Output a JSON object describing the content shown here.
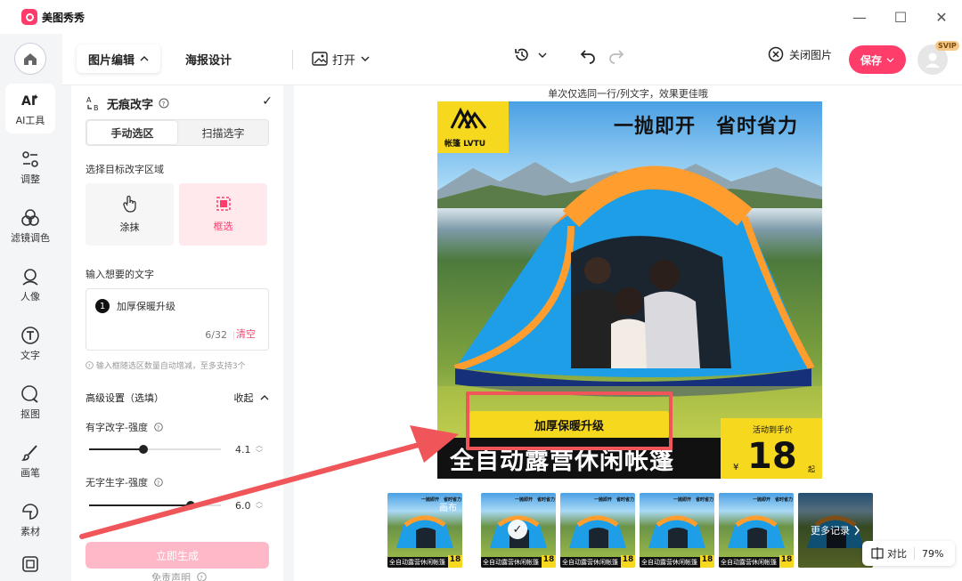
{
  "app": {
    "title": "美图秀秀"
  },
  "window": {
    "minimize": "—",
    "maximize": "☐",
    "close": "✕"
  },
  "rail": {
    "items": [
      {
        "label": "AI工具",
        "icon": "ai-tools-icon",
        "active": true
      },
      {
        "label": "调整",
        "icon": "adjust-icon"
      },
      {
        "label": "滤镜调色",
        "icon": "filter-icon"
      },
      {
        "label": "人像",
        "icon": "portrait-icon"
      },
      {
        "label": "文字",
        "icon": "text-icon"
      },
      {
        "label": "抠图",
        "icon": "cutout-icon"
      },
      {
        "label": "画笔",
        "icon": "brush-icon"
      },
      {
        "label": "素材",
        "icon": "material-icon"
      }
    ]
  },
  "toolbar": {
    "tab_edit": "图片编辑",
    "tab_poster": "海报设计",
    "open": "打开",
    "close_image": "关闭图片",
    "save": "保存",
    "svip": "SVIP"
  },
  "panel": {
    "title": "无痕改字",
    "tab_manual": "手动选区",
    "tab_scan": "扫描选字",
    "select_area_label": "选择目标改字区域",
    "tool_smear": "涂抹",
    "tool_frame": "框选",
    "input_label": "输入想要的文字",
    "entry_index": "1",
    "entry_text": "加厚保暖升级",
    "char_count": "6/32",
    "clear": "清空",
    "hint": "输入框随选区数量自动增减，至多支持3个",
    "advanced_label": "高级设置（选填）",
    "collapse": "收起",
    "slider1_label": "有字改字-强度",
    "slider1_value": "4.1",
    "slider1_level": 0.41,
    "slider2_label": "无字生字-强度",
    "slider2_value": "6.0",
    "slider2_level": 0.77,
    "generate": "立即生成",
    "disclaimer": "免责声明"
  },
  "canvas": {
    "hint": "单次仅选同一行/列文字，效果更佳哦",
    "brand": "帐篷 LVTU",
    "headline": "一抛即开　省时省力",
    "yellow_text": "加厚保暖升级",
    "black_text": "全自动露营休闲帐篷",
    "price_label": "活动到手价",
    "price_value": "18",
    "price_currency": "¥",
    "price_suffix": "起"
  },
  "thumbnails": {
    "original_tag": "画布",
    "band_text": "全自动露营休闲帐篷",
    "price": "18",
    "head": "一抛即开　省时省力",
    "more": "更多记录",
    "compare": "对比",
    "zoom": "79%"
  },
  "colors": {
    "accent": "#ff3d6b",
    "poster_yellow": "#f6d81e",
    "annotation_red": "#f0555a"
  }
}
